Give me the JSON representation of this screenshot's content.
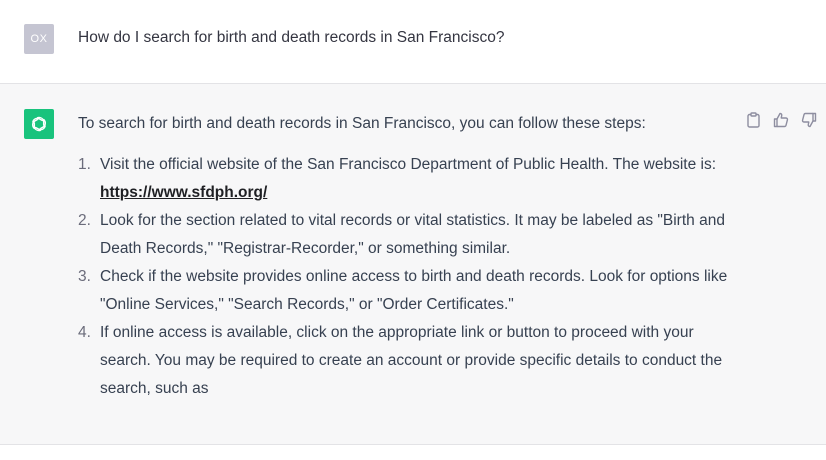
{
  "user_message": {
    "avatar_initials": "OX",
    "text": "How do I search for birth and death records in San Francisco?"
  },
  "assistant_message": {
    "intro": "To search for birth and death records in San Francisco, you can follow these steps:",
    "steps": [
      {
        "number": "1.",
        "text": "Visit the official website of the San Francisco Department of Public Health. The website is: ",
        "link": "https://www.sfdph.org/"
      },
      {
        "number": "2.",
        "text": "Look for the section related to vital records or vital statistics. It may be labeled as \"Birth and Death Records,\" \"Registrar-Recorder,\" or something similar."
      },
      {
        "number": "3.",
        "text": "Check if the website provides online access to birth and death records. Look for options like \"Online Services,\" \"Search Records,\" or \"Order Certificates.\""
      },
      {
        "number": "4.",
        "text": "If online access is available, click on the appropriate link or button to proceed with your search. You may be required to create an account or provide specific details to conduct the search, such as"
      }
    ]
  },
  "icons": {
    "avatar_assistant": "openai-logo-icon",
    "copy": "clipboard-icon",
    "like": "thumbs-up-icon",
    "dislike": "thumbs-down-icon"
  },
  "colors": {
    "assistant_avatar_bg": "#19c37d",
    "user_avatar_bg": "#c5c5d2",
    "assistant_row_bg": "#f7f7f8"
  }
}
